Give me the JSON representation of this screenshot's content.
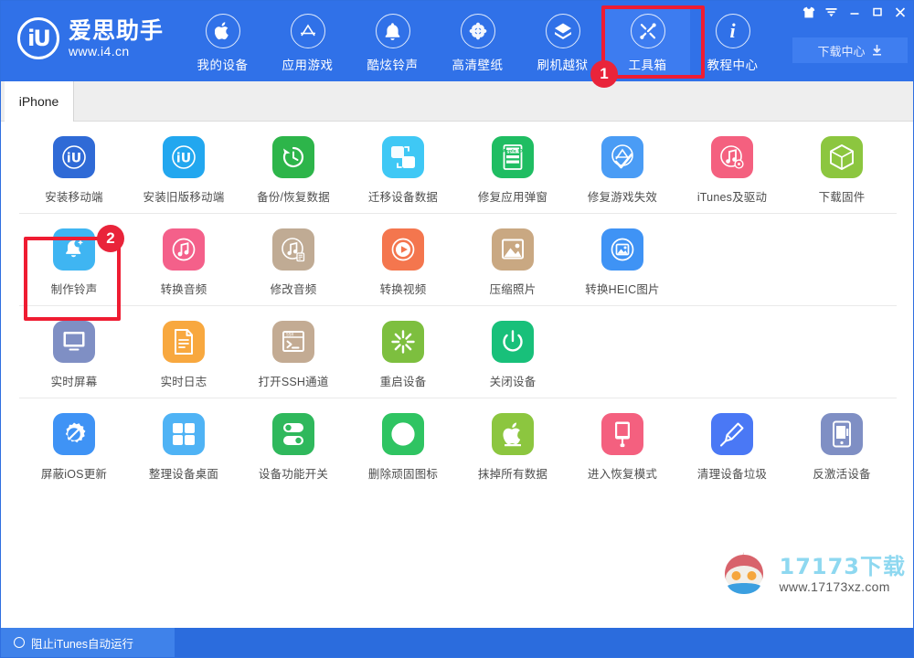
{
  "window": {
    "controls": [
      {
        "name": "skin-icon",
        "glyph": "shirt"
      },
      {
        "name": "menu-icon",
        "glyph": "menu"
      },
      {
        "name": "minimize-icon",
        "glyph": "minimize"
      },
      {
        "name": "maximize-icon",
        "glyph": "maximize"
      },
      {
        "name": "close-icon",
        "glyph": "close"
      }
    ]
  },
  "brand": {
    "mark": "iU",
    "title": "爱思助手",
    "url": "www.i4.cn"
  },
  "nav": {
    "items": [
      {
        "label": "我的设备",
        "icon": "apple-icon",
        "active": false
      },
      {
        "label": "应用游戏",
        "icon": "appstore-icon",
        "active": false
      },
      {
        "label": "酷炫铃声",
        "icon": "bell-icon",
        "active": false
      },
      {
        "label": "高清壁纸",
        "icon": "wallpaper-icon",
        "active": false
      },
      {
        "label": "刷机越狱",
        "icon": "flash-jailbreak-icon",
        "active": false
      },
      {
        "label": "工具箱",
        "icon": "toolbox-icon",
        "active": true
      },
      {
        "label": "教程中心",
        "icon": "info-icon",
        "active": false
      }
    ]
  },
  "download_center": {
    "label": "下载中心",
    "icon": "download-icon"
  },
  "tabs": [
    {
      "label": "iPhone",
      "active": true
    }
  ],
  "tool_rows": [
    {
      "tools": [
        {
          "label": "安装移动端",
          "icon": "i4-install-icon",
          "bg": "#2f6ad6",
          "accent": "#ffffff"
        },
        {
          "label": "安装旧版移动端",
          "icon": "i4-install-old-icon",
          "bg": "#22a7ef",
          "accent": "#ffffff"
        },
        {
          "label": "备份/恢复数据",
          "icon": "backup-restore-icon",
          "bg": "#2db54a",
          "accent": "#ffffff"
        },
        {
          "label": "迁移设备数据",
          "icon": "migrate-data-icon",
          "bg": "#3fc8f5",
          "accent": "#ffffff"
        },
        {
          "label": "修复应用弹窗",
          "icon": "appleid-popup-fix-icon",
          "bg": "#1fbd62",
          "accent": "#ffffff"
        },
        {
          "label": "修复游戏失效",
          "icon": "game-fix-icon",
          "bg": "#4a9cf5",
          "accent": "#ffffff"
        },
        {
          "label": "iTunes及驱动",
          "icon": "itunes-driver-icon",
          "bg": "#f4607f",
          "accent": "#ffffff"
        },
        {
          "label": "下载固件",
          "icon": "firmware-download-icon",
          "bg": "#8cc63f",
          "accent": "#ffffff"
        }
      ]
    },
    {
      "tools": [
        {
          "label": "制作铃声",
          "icon": "make-ringtone-icon",
          "bg": "#3fb5f2",
          "accent": "#ffffff"
        },
        {
          "label": "转换音频",
          "icon": "convert-audio-icon",
          "bg": "#f4608a",
          "accent": "#ffffff"
        },
        {
          "label": "修改音频",
          "icon": "edit-audio-icon",
          "bg": "#c0ab94",
          "accent": "#ffffff"
        },
        {
          "label": "转换视频",
          "icon": "convert-video-icon",
          "bg": "#f4764e",
          "accent": "#ffffff"
        },
        {
          "label": "压缩照片",
          "icon": "compress-photo-icon",
          "bg": "#c9a882",
          "accent": "#ffffff"
        },
        {
          "label": "转换HEIC图片",
          "icon": "convert-heic-icon",
          "bg": "#3f93f5",
          "accent": "#ffffff"
        }
      ]
    },
    {
      "tools": [
        {
          "label": "实时屏幕",
          "icon": "realtime-screen-icon",
          "bg": "#7f8fc4",
          "accent": "#ffffff"
        },
        {
          "label": "实时日志",
          "icon": "realtime-log-icon",
          "bg": "#f8a83f",
          "accent": "#ffffff"
        },
        {
          "label": "打开SSH通道",
          "icon": "ssh-tunnel-icon",
          "bg": "#c3ab93",
          "accent": "#ffffff"
        },
        {
          "label": "重启设备",
          "icon": "reboot-device-icon",
          "bg": "#7dbf3f",
          "accent": "#ffffff"
        },
        {
          "label": "关闭设备",
          "icon": "shutdown-device-icon",
          "bg": "#18c07a",
          "accent": "#ffffff"
        }
      ]
    },
    {
      "tools": [
        {
          "label": "屏蔽iOS更新",
          "icon": "block-ios-update-icon",
          "bg": "#3f93f5",
          "accent": "#ffffff"
        },
        {
          "label": "整理设备桌面",
          "icon": "organize-desktop-icon",
          "bg": "#4fb3f5",
          "accent": "#ffffff"
        },
        {
          "label": "设备功能开关",
          "icon": "feature-toggle-icon",
          "bg": "#2fb85c",
          "accent": "#ffffff"
        },
        {
          "label": "删除顽固图标",
          "icon": "remove-stubborn-icon",
          "bg": "#2fc462",
          "accent": "#ffffff"
        },
        {
          "label": "抹掉所有数据",
          "icon": "erase-all-data-icon",
          "bg": "#8cc63f",
          "accent": "#ffffff"
        },
        {
          "label": "进入恢复模式",
          "icon": "recovery-mode-icon",
          "bg": "#f4607f",
          "accent": "#ffffff"
        },
        {
          "label": "清理设备垃圾",
          "icon": "clean-junk-icon",
          "bg": "#4a78f5",
          "accent": "#ffffff"
        },
        {
          "label": "反激活设备",
          "icon": "deactivate-device-icon",
          "bg": "#7f8fc4",
          "accent": "#ffffff"
        }
      ]
    }
  ],
  "annotations": [
    {
      "number": "1",
      "target": "工具箱"
    },
    {
      "number": "2",
      "target": "制作铃声"
    }
  ],
  "watermark": {
    "title": "17173下载",
    "url": "www.17173xz.com"
  },
  "statusbar": {
    "label": "阻止iTunes自动运行"
  },
  "colors": {
    "header_bg": "#3071e8",
    "accent_red": "#ef1c32",
    "badge_red": "#e9243a",
    "statusbar_bg": "#2b6cdd",
    "status_left_bg": "#3f82ea"
  }
}
